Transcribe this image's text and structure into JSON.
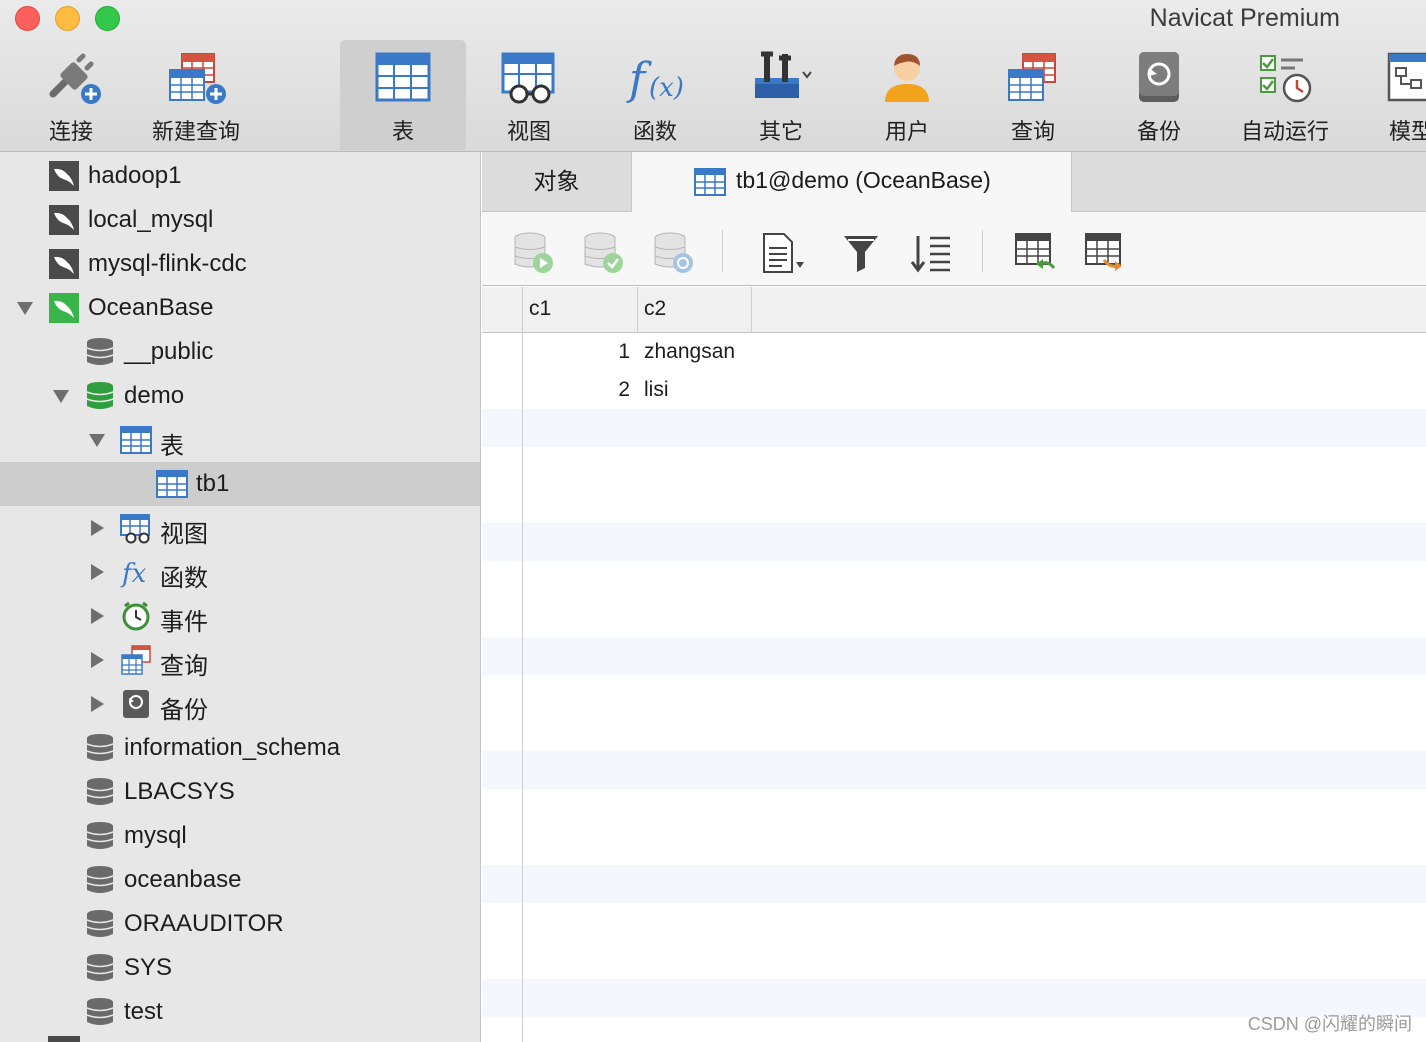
{
  "app_title": "Navicat Premium",
  "toolbar": {
    "items": [
      {
        "label": "连接",
        "icon": "connection-icon"
      },
      {
        "label": "新建查询",
        "icon": "new-query-icon"
      },
      {
        "label": "表",
        "icon": "table-icon",
        "active": true
      },
      {
        "label": "视图",
        "icon": "view-icon"
      },
      {
        "label": "函数",
        "icon": "function-icon"
      },
      {
        "label": "其它",
        "icon": "tools-icon"
      },
      {
        "label": "用户",
        "icon": "user-icon"
      },
      {
        "label": "查询",
        "icon": "query-icon"
      },
      {
        "label": "备份",
        "icon": "backup-icon"
      },
      {
        "label": "自动运行",
        "icon": "automation-icon"
      },
      {
        "label": "模型",
        "icon": "model-icon"
      }
    ]
  },
  "sidebar": {
    "nodes": [
      {
        "label": "hadoop1",
        "icon": "mysql-connection-icon"
      },
      {
        "label": "local_mysql",
        "icon": "mysql-connection-icon"
      },
      {
        "label": "mysql-flink-cdc",
        "icon": "mysql-connection-icon"
      },
      {
        "label": "OceanBase",
        "icon": "mysql-connection-active-icon"
      },
      {
        "label": "__public",
        "icon": "database-icon"
      },
      {
        "label": "demo",
        "icon": "database-active-icon"
      },
      {
        "label": "表",
        "icon": "table-icon"
      },
      {
        "label": "tb1",
        "icon": "table-icon"
      },
      {
        "label": "视图",
        "icon": "view-icon"
      },
      {
        "label": "函数",
        "icon": "function-icon"
      },
      {
        "label": "事件",
        "icon": "event-clock-icon"
      },
      {
        "label": "查询",
        "icon": "query-icon"
      },
      {
        "label": "备份",
        "icon": "backup-icon"
      },
      {
        "label": "information_schema",
        "icon": "database-icon"
      },
      {
        "label": "LBACSYS",
        "icon": "database-icon"
      },
      {
        "label": "mysql",
        "icon": "database-icon"
      },
      {
        "label": "oceanbase",
        "icon": "database-icon"
      },
      {
        "label": "ORAAUDITOR",
        "icon": "database-icon"
      },
      {
        "label": "SYS",
        "icon": "database-icon"
      },
      {
        "label": "test",
        "icon": "database-icon"
      }
    ]
  },
  "tabs": {
    "objects_label": "对象",
    "table_tab_label": "tb1@demo (OceanBase)"
  },
  "grid": {
    "columns": [
      "c1",
      "c2"
    ],
    "rows": [
      [
        "1",
        "zhangsan"
      ],
      [
        "2",
        "lisi"
      ]
    ]
  },
  "watermark": "CSDN @闪耀的瞬间",
  "colors": {
    "accent_blue": "#3f7fc6",
    "mysql_green": "#39b54a",
    "row_stripe": "#f4f7fd",
    "selected_row": "#cdcdcd"
  }
}
